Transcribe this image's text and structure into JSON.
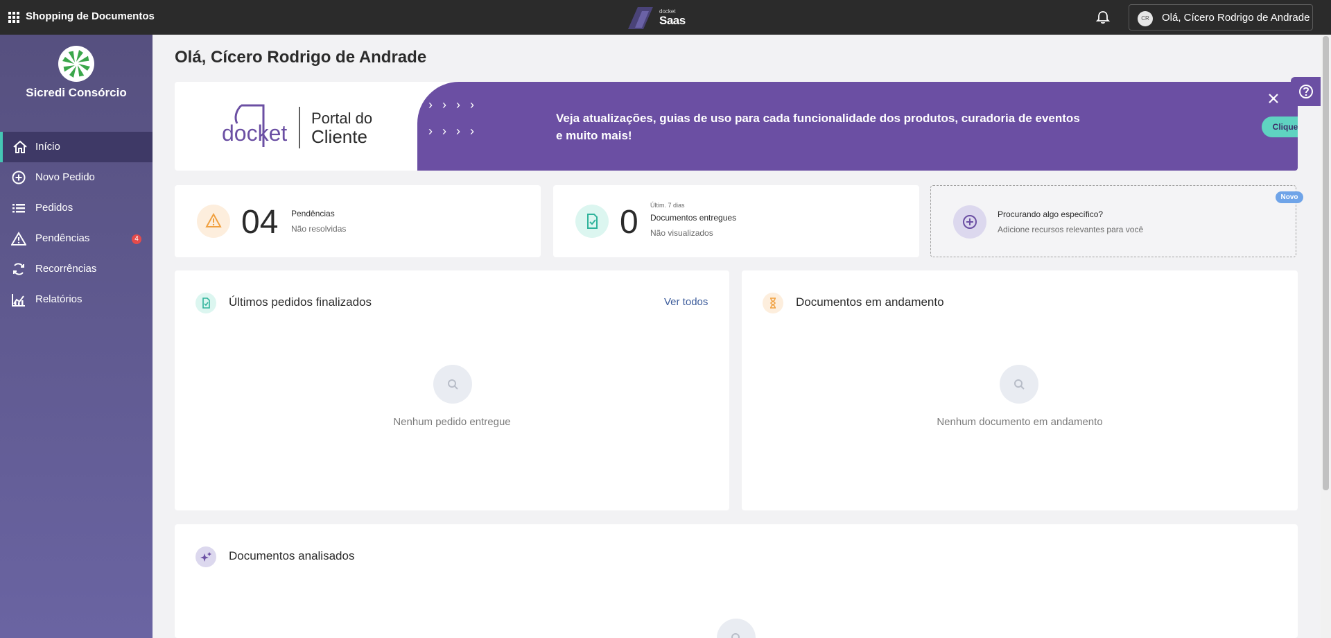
{
  "topbar": {
    "app_title": "Shopping de Documentos",
    "brand_small": "docket",
    "brand_large": "Saas",
    "user_initials": "CR",
    "user_greeting": "Olá, Cícero Rodrigo de Andrade"
  },
  "sidebar": {
    "org_name": "Sicredi Consórcio",
    "items": [
      {
        "label": "Início",
        "icon": "home-icon",
        "active": true
      },
      {
        "label": "Novo Pedido",
        "icon": "plus-circle-icon"
      },
      {
        "label": "Pedidos",
        "icon": "list-icon"
      },
      {
        "label": "Pendências",
        "icon": "warning-icon",
        "badge": "4"
      },
      {
        "label": "Recorrências",
        "icon": "refresh-icon"
      },
      {
        "label": "Relatórios",
        "icon": "chart-icon"
      }
    ]
  },
  "main": {
    "greeting": "Olá, Cícero Rodrigo de Andrade",
    "banner": {
      "logo_word": "docket",
      "logo_line1": "Portal do",
      "logo_line2": "Cliente",
      "text": "Veja atualizações, guias de uso para cada funcionalidade dos produtos, curadoria de eventos e muito mais!",
      "cta": "Clique aqui"
    },
    "stats": {
      "pending": {
        "number": "04",
        "line1": "Pendências",
        "line2": "Não resolvidas"
      },
      "delivered": {
        "number": "0",
        "small": "Últim. 7 dias",
        "line1": "Documentos entregues",
        "line2": "Não visualizados"
      },
      "discover": {
        "badge": "Novo",
        "line1": "Procurando algo específico?",
        "line2": "Adicione recursos relevantes para você"
      }
    },
    "panels": {
      "finished": {
        "title": "Últimos pedidos finalizados",
        "link": "Ver todos",
        "empty": "Nenhum pedido entregue"
      },
      "in_progress": {
        "title": "Documentos em andamento",
        "empty": "Nenhum documento em andamento"
      },
      "analyzed": {
        "title": "Documentos analisados"
      }
    }
  },
  "colors": {
    "sidebar_top": "#56507f",
    "accent_purple": "#6b4fa3",
    "accent_teal": "#5fd3c1",
    "badge_red": "#e54b4b"
  }
}
